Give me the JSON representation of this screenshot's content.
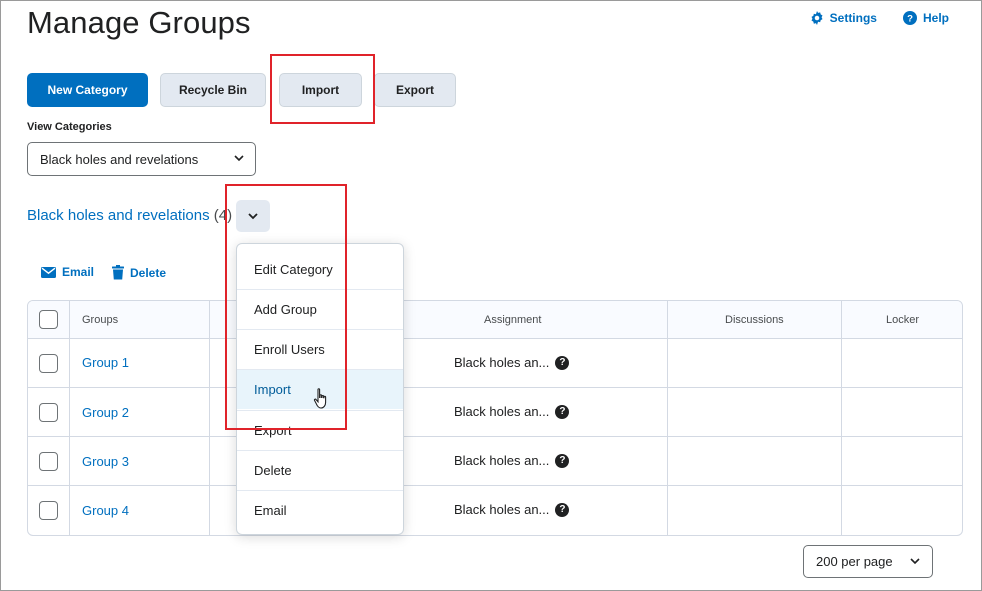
{
  "page": {
    "title": "Manage Groups"
  },
  "top_links": [
    {
      "label": "Settings",
      "icon": "gear-icon"
    },
    {
      "label": "Help",
      "icon": "help-circle-icon"
    }
  ],
  "toolbar": {
    "new_category": "New Category",
    "recycle_bin": "Recycle Bin",
    "import": "Import",
    "export": "Export"
  },
  "view_categories": {
    "label": "View Categories",
    "selected": "Black holes and revelations"
  },
  "category": {
    "name": "Black holes and revelations",
    "count": "(4)"
  },
  "actions": {
    "email": "Email",
    "delete": "Delete"
  },
  "table": {
    "headers": [
      "Groups",
      "Assignment",
      "Discussions",
      "Locker"
    ],
    "rows": [
      {
        "group": "Group 1",
        "assignment": "Black holes an..."
      },
      {
        "group": "Group 2",
        "assignment": "Black holes an..."
      },
      {
        "group": "Group 3",
        "assignment": "Black holes an..."
      },
      {
        "group": "Group 4",
        "assignment": "Black holes an..."
      }
    ]
  },
  "context_menu": {
    "items": [
      "Edit Category",
      "Add Group",
      "Enroll Users",
      "Import",
      "Export",
      "Delete",
      "Email"
    ],
    "hovered": "Import"
  },
  "pagination": {
    "per_page": "200 per page"
  },
  "colors": {
    "accent": "#006fbf",
    "highlight": "#e0232a",
    "secondary_button": "#e3e9f1"
  }
}
